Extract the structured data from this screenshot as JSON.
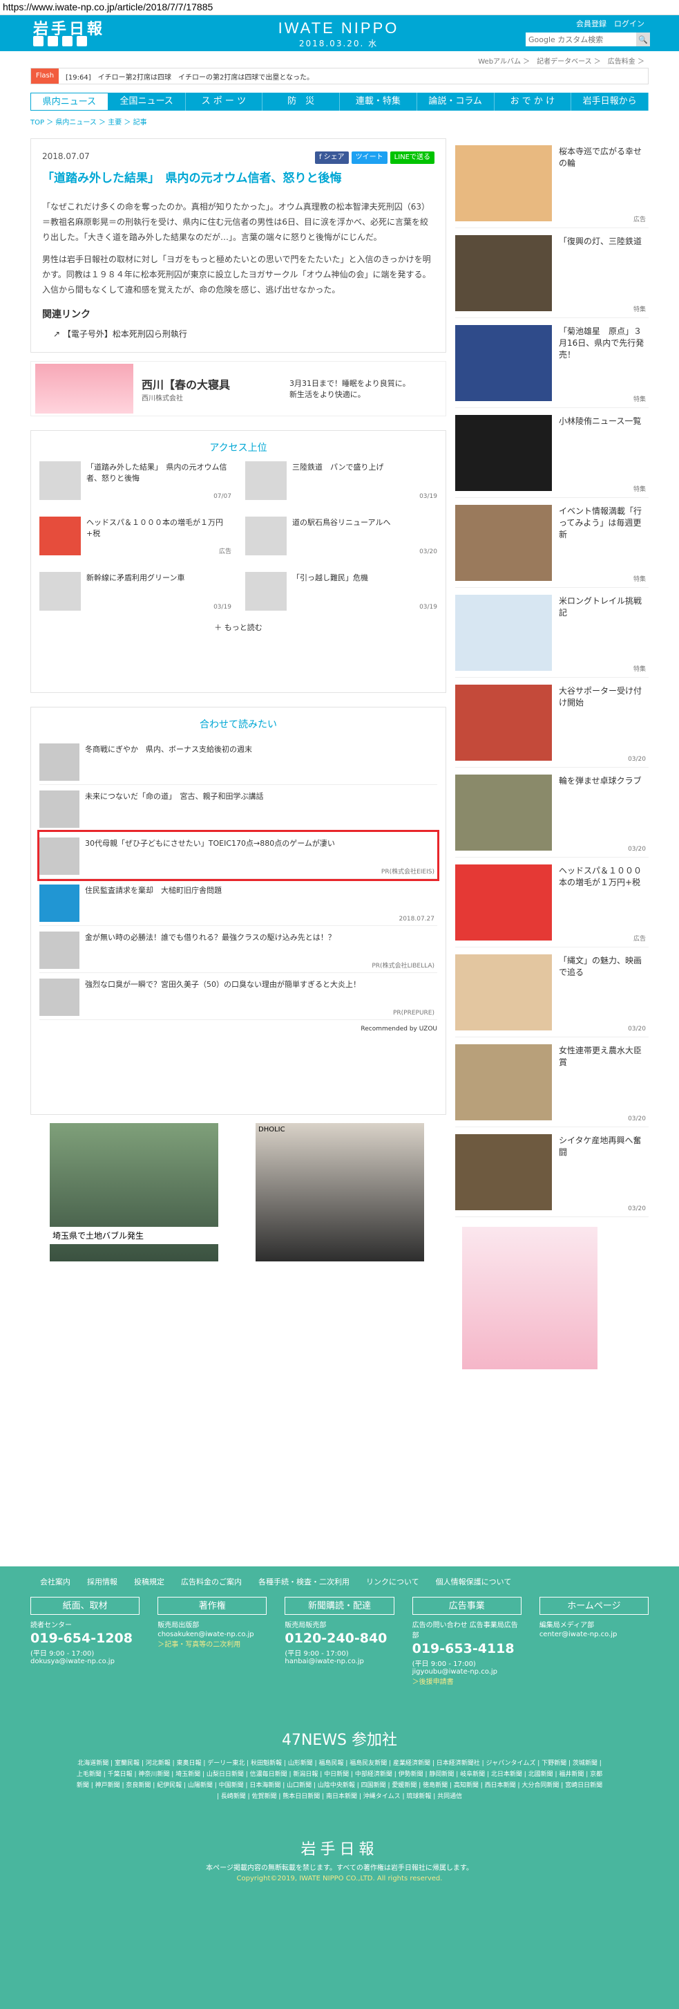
{
  "url": "https://www.iwate-np.co.jp/article/2018/7/7/17885",
  "header": {
    "logo": "岩手日報",
    "brand": "IWATE NIPPO",
    "date": "2018.03.20. 水",
    "member": "会員登録",
    "login": "ログイン",
    "search_placeholder": "Google カスタム検索",
    "search_btn": "🔍"
  },
  "subnav": "Webアルバム ＞　記者データベース ＞　広告料金 ＞",
  "flash": {
    "label": "Flash",
    "text": "[19:64]　イチロー第2打席は四球　イチローの第2打席は四球で出塁となった。"
  },
  "nav": [
    "県内ニュース",
    "全国ニュース",
    "ス ポ ー ツ",
    "防　災",
    "連載・特集",
    "論説・コラム",
    "お で か け",
    "岩手日報から"
  ],
  "breadcrumb": "TOP ＞ 県内ニュース ＞ 主要 ＞ 記事",
  "article": {
    "date": "2018.07.07",
    "share": [
      "f シェア",
      "ツイート",
      "LINEで送る"
    ],
    "title": "「道踏み外した結果」　県内の元オウム信者、怒りと後悔",
    "p1": "「なぜこれだけ多くの命を奪ったのか。真相が知りたかった」。オウム真理教の松本智津夫死刑囚（63）＝教祖名麻原彰晃＝の刑執行を受け、県内に住む元信者の男性は6日、目に涙を浮かべ、必死に言葉を絞り出した。「大きく道を踏み外した結果なのだが…」。言葉の端々に怒りと後悔がにじんだ。",
    "p2": "男性は岩手日報社の取材に対し「ヨガをもっと極めたいとの思いで門をたたいた」と入信のきっかけを明かす。同教は１９８４年に松本死刑囚が東京に設立したヨガサークル「オウム神仙の会」に端を発する。入信から間もなくして違和感を覚えたが、命の危険を感じ、逃げ出せなかった。",
    "related_h": "関連リンク",
    "related": "【電子号外】松本死刑囚ら刑執行"
  },
  "ad1": {
    "title": "西川【春の大寝具",
    "sub": "西川株式会社",
    "body": "3月31日まで！睡眠をより良質に。新生活をより快適に。"
  },
  "access": {
    "title": "アクセス上位",
    "items": [
      {
        "t": "「道踏み外した結果」　県内の元オウム信者、怒りと後悔",
        "d": "07/07"
      },
      {
        "t": "三陸鉄道　パンで盛り上げ",
        "d": "03/19"
      },
      {
        "t": "ヘッドスパ＆１０００本の増毛が１万円+税",
        "d": "広告"
      },
      {
        "t": "道の駅石鳥谷リニューアルへ",
        "d": "03/20"
      },
      {
        "t": "新幹線に矛盾利用グリーン車",
        "d": "03/19"
      },
      {
        "t": "「引っ越し難民」危機",
        "d": "03/19"
      }
    ],
    "more": "もっと読む"
  },
  "recommend": {
    "title": "合わせて読みたい",
    "items": [
      {
        "t": "冬商戦にぎやか　県内、ボーナス支給後初の週末",
        "m": ""
      },
      {
        "t": "未来につないだ「命の道」　宮古、親子和田学ぶ講話",
        "m": ""
      },
      {
        "t": "30代母親「ぜひ子どもにさせたい」TOEIC170点→880点のゲームが凄い",
        "m": "PR(株式会社EIEIS)"
      },
      {
        "t": "住民監査請求を棄却　大槌町旧庁舎問題",
        "m": "2018.07.27"
      },
      {
        "t": "金が無い時の必勝法！誰でも借りれる？最強クラスの駆け込み先とは！？",
        "m": "PR(株式会社LIBELLA)"
      },
      {
        "t": "強烈な口臭が一瞬で？宮田久美子（50）の口臭ない理由が簡単すぎると大炎上！",
        "m": "PR(PREPURE)"
      }
    ],
    "by": "Recommended by UZOU"
  },
  "ads2": {
    "a": "埼玉県で土地バブル発生",
    "b": "DHOLIC"
  },
  "side": [
    {
      "t": "桜本寺巡で広がる幸せの輪",
      "g": "広告"
    },
    {
      "t": "「復興の灯、三陸鉄道",
      "g": "特集"
    },
    {
      "t": "「菊池雄星　原点」３月16日、県内で先行発売！",
      "g": "特集"
    },
    {
      "t": "小林陵侑ニュース一覧",
      "g": "特集"
    },
    {
      "t": "イベント情報満載「行ってみよう」は毎週更新",
      "g": "特集"
    },
    {
      "t": "米ロングトレイル挑戦記",
      "g": "特集"
    },
    {
      "t": "大谷サポーター受け付け開始",
      "g": "03/20"
    },
    {
      "t": "輪を弾ませ卓球クラブ",
      "g": "03/20"
    },
    {
      "t": "ヘッドスパ＆１０００本の増毛が１万円+税",
      "g": "広告"
    },
    {
      "t": "「縄文」の魅力、映画で追る",
      "g": "03/20"
    },
    {
      "t": "女性連帯更え農水大臣賞",
      "g": "03/20"
    },
    {
      "t": "シイタケ産地再興へ奮闘",
      "g": "03/20"
    }
  ],
  "footer": {
    "links": [
      "会社案内",
      "採用情報",
      "投稿規定",
      "広告料金のご案内",
      "各種手続・検査・二次利用",
      "リンクについて",
      "個人情報保護について"
    ],
    "cols": [
      {
        "btn": "紙面、取材",
        "l1": "読者センター",
        "tel": "019-654-1208",
        "hours": "(平日 9:00 - 17:00)",
        "mail": "dokusya@iwate-np.co.jp",
        "note": ""
      },
      {
        "btn": "著作権",
        "l1": "販売局出版部",
        "tel": "",
        "hours": "",
        "mail": "chosakuken@iwate-np.co.jp",
        "note": "＞記事・写真等の二次利用"
      },
      {
        "btn": "新聞購読・配達",
        "l1": "販売局販売部",
        "tel": "0120-240-840",
        "hours": "(平日 9:00 - 17:00)",
        "mail": "hanbai@iwate-np.co.jp",
        "note": ""
      },
      {
        "btn": "広告事業",
        "l1": "広告の問い合わせ 広告事業局広告部",
        "tel": "019-653-4118",
        "hours": "(平日 9:00 - 17:00)",
        "mail": "jigyoubu@iwate-np.co.jp",
        "note": "＞後援申請書"
      },
      {
        "btn": "ホームページ",
        "l1": "編集局メディア部",
        "tel": "",
        "hours": "",
        "mail": "center@iwate-np.co.jp",
        "note": ""
      }
    ],
    "h47": "47NEWS 参加社",
    "papers": "北海道新聞 | 室蘭民報 | 河北新報 | 東奥日報 | デーリー東北 | 秋田魁新報 | 山形新聞 | 福島民報 | 福島民友新聞 | 産業経済新聞 | 日本経済新聞社 | ジャパンタイムズ | 下野新聞 | 茨城新聞 | 上毛新聞 | 千葉日報 | 神奈川新聞 | 埼玉新聞 | 山梨日日新聞 | 信濃毎日新聞 | 新潟日報 | 中日新聞 | 中部経済新聞 | 伊勢新聞 | 静岡新聞 | 岐阜新聞 | 北日本新聞 | 北國新聞 | 福井新聞 | 京都新聞 | 神戸新聞 | 奈良新聞 | 紀伊民報 | 山陽新聞 | 中国新聞 | 日本海新聞 | 山口新聞 | 山陰中央新報 | 四国新聞 | 愛媛新聞 | 徳島新聞 | 高知新聞 | 西日本新聞 | 大分合同新聞 | 宮崎日日新聞 | 長崎新聞 | 佐賀新聞 | 熊本日日新聞 | 南日本新聞 | 沖縄タイムス | 琉球新報 | 共同通信",
    "logo": "岩手日報",
    "notice": "本ページ掲載内容の無断転載を禁じます。すべての著作権は岩手日報社に帰属します。",
    "copy": "Copyright©2019, IWATE NIPPO CO.,LTD. All rights reserved."
  }
}
